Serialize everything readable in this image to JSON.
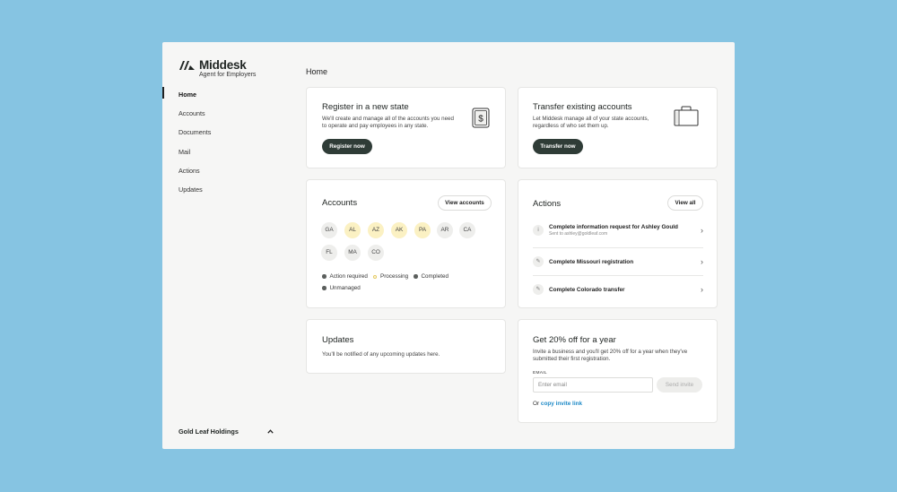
{
  "brand": {
    "name": "Middesk",
    "subtitle": "Agent for Employers"
  },
  "sidebar": {
    "items": [
      {
        "label": "Home",
        "active": true
      },
      {
        "label": "Accounts"
      },
      {
        "label": "Documents"
      },
      {
        "label": "Mail"
      },
      {
        "label": "Actions"
      },
      {
        "label": "Updates"
      }
    ],
    "org": {
      "name": "Gold Leaf Holdings",
      "icon": "chevron-up-icon"
    }
  },
  "main": {
    "title": "Home"
  },
  "register": {
    "title": "Register in a new state",
    "description": "We'll create and manage all of the accounts you need to operate and pay employees in any state.",
    "button": "Register now",
    "icon": "dollar-document-icon"
  },
  "transfer": {
    "title": "Transfer existing accounts",
    "description": "Let Middesk manage all of your state accounts, regardless of who set them up.",
    "button": "Transfer now",
    "icon": "briefcase-icon"
  },
  "accounts": {
    "title": "Accounts",
    "button": "View accounts",
    "states": [
      {
        "code": "GA",
        "status": "unmanaged"
      },
      {
        "code": "AL",
        "status": "processing"
      },
      {
        "code": "AZ",
        "status": "processing"
      },
      {
        "code": "AK",
        "status": "processing"
      },
      {
        "code": "PA",
        "status": "processing"
      },
      {
        "code": "AR",
        "status": "unmanaged"
      },
      {
        "code": "CA",
        "status": "unmanaged"
      },
      {
        "code": "FL",
        "status": "unmanaged"
      },
      {
        "code": "MA",
        "status": "unmanaged"
      },
      {
        "code": "CO",
        "status": "unmanaged"
      }
    ],
    "legend": [
      "Action required",
      "Processing",
      "Completed",
      "Unmanaged"
    ],
    "colors": {
      "processing": "#fbf1c3",
      "unmanaged": "#eeeeec",
      "dot": "#5b5f5d"
    }
  },
  "actions": {
    "title": "Actions",
    "button": "View all",
    "items": [
      {
        "title": "Complete information request for Ashley Gould",
        "subtitle": "Sent to ashley@goldleaf.com",
        "icon": "info-icon"
      },
      {
        "title": "Complete Missouri registration",
        "subtitle": "",
        "icon": "pencil-icon"
      },
      {
        "title": "Complete Colorado transfer",
        "subtitle": "",
        "icon": "pencil-icon"
      }
    ]
  },
  "updates": {
    "title": "Updates",
    "description": "You'll be notified of any upcoming updates here."
  },
  "referral": {
    "title": "Get 20% off for a year",
    "description": "Invite a business and you'll get 20% off for a year when they've submitted their first registration.",
    "email_label": "EMAIL",
    "email_placeholder": "Enter email",
    "email_value": "",
    "send_button": "Send invite",
    "copy_prefix": "Or",
    "copy_link": "copy invite link"
  },
  "theme": {
    "background": "#86c4e2",
    "primary_button": "#2f3c37",
    "link": "#1f8ac7"
  }
}
